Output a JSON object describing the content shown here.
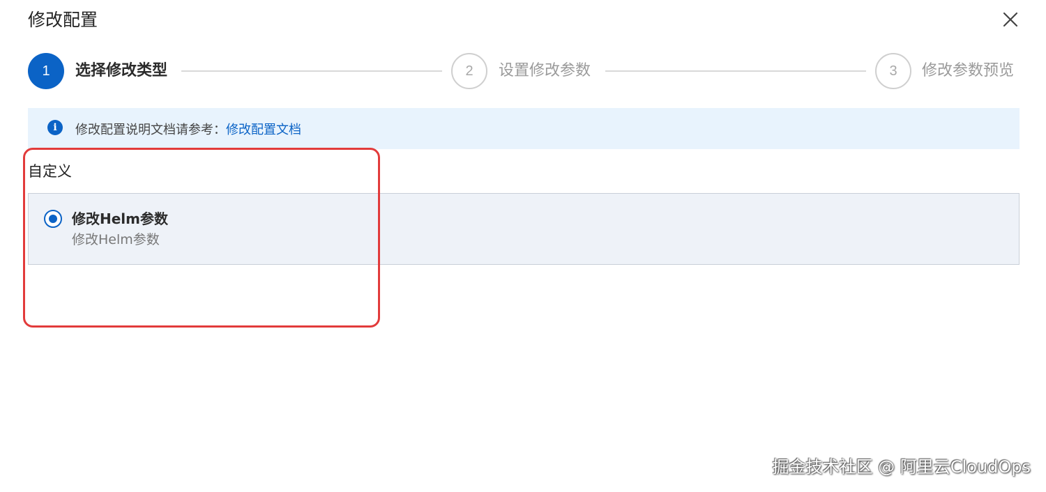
{
  "dialog": {
    "title": "修改配置",
    "close_icon": "close-icon"
  },
  "steps": [
    {
      "number": "1",
      "label": "选择修改类型",
      "state": "active"
    },
    {
      "number": "2",
      "label": "设置修改参数",
      "state": "inactive"
    },
    {
      "number": "3",
      "label": "修改参数预览",
      "state": "inactive"
    }
  ],
  "info": {
    "icon": "info-icon",
    "icon_glyph": "i",
    "text": "修改配置说明文档请参考：",
    "link": "修改配置文档"
  },
  "section": {
    "title": "自定义",
    "option": {
      "title": "修改Helm参数",
      "description": "修改Helm参数",
      "selected": true
    }
  },
  "watermark": "掘金技术社区 @ 阿里云CloudOps",
  "colors": {
    "primary": "#0b63c6",
    "banner_bg": "#e8f3fd",
    "card_bg": "#eef2f8",
    "highlight": "#e23b3b"
  }
}
